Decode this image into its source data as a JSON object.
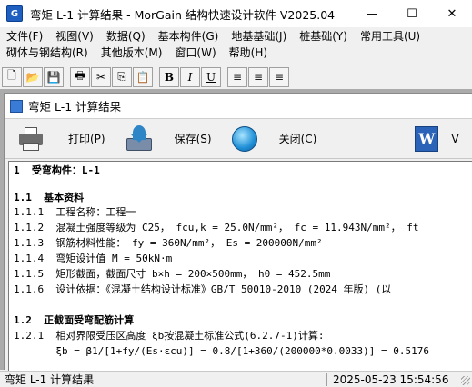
{
  "app": {
    "title": "弯矩 L-1 计算结果 - MorGain 结构快速设计软件 V2025.04",
    "icon_label": "G",
    "icon_name": "morgain-app-icon"
  },
  "window_controls": {
    "minimize": "—",
    "maximize": "☐",
    "close": "✕"
  },
  "menu_row1": [
    "文件(F)",
    "视图(V)",
    "数据(Q)",
    "基本构件(G)",
    "地基基础(J)",
    "桩基础(Y)",
    "常用工具(U)"
  ],
  "menu_row2": [
    "砌体与钢结构(R)",
    "其他版本(M)",
    "窗口(W)",
    "帮助(H)"
  ],
  "toolbar": {
    "new": "🗋",
    "open": "📂",
    "save": "💾",
    "print": "🖶",
    "cut": "✂",
    "copy": "⎘",
    "paste": "📋",
    "bold": "B",
    "italic": "I",
    "underline": "U",
    "align_left": "≡",
    "align_center": "≡",
    "align_right": "≡"
  },
  "child_window": {
    "title": "弯矩 L-1 计算结果",
    "print_label": "打印(P)",
    "save_label": "保存(S)",
    "close_label": "关闭(C)",
    "word_icon_letter": "W",
    "word_label": "V"
  },
  "document": {
    "lines": [
      {
        "text": "1  受弯构件：L-1",
        "head": true
      },
      {
        "text": "",
        "head": false
      },
      {
        "text": "1.1  基本资料",
        "head": true
      },
      {
        "text": "1.1.1  工程名称：工程一",
        "head": false
      },
      {
        "text": "1.1.2  混凝土强度等级为 C25， fcu,k = 25.0N/mm²， fc = 11.943N/mm²， ft",
        "head": false
      },
      {
        "text": "1.1.3  钢筋材料性能： fy = 360N/mm²， Es = 200000N/mm²",
        "head": false
      },
      {
        "text": "1.1.4  弯矩设计值 M = 50kN·m",
        "head": false
      },
      {
        "text": "1.1.5  矩形截面，截面尺寸 b×h = 200×500mm， h0 = 452.5mm",
        "head": false
      },
      {
        "text": "1.1.6  设计依据：《混凝土结构设计标准》GB/T 50010-2010 (2024 年版) (以",
        "head": false
      },
      {
        "text": "",
        "head": false
      },
      {
        "text": "1.2  正截面受弯配筋计算",
        "head": true
      },
      {
        "text": "1.2.1  相对界限受压区高度 ξb按混凝土标准公式(6.2.7-1)计算:",
        "head": false
      },
      {
        "text": "       ξb = β1/[1+fy/(Es·εcu)] = 0.8/[1+360/(200000*0.0033)] = 0.5176",
        "head": false
      }
    ]
  },
  "status": {
    "left": "弯矩 L-1 计算结果",
    "right": "2025-05-23 15:54:56"
  }
}
